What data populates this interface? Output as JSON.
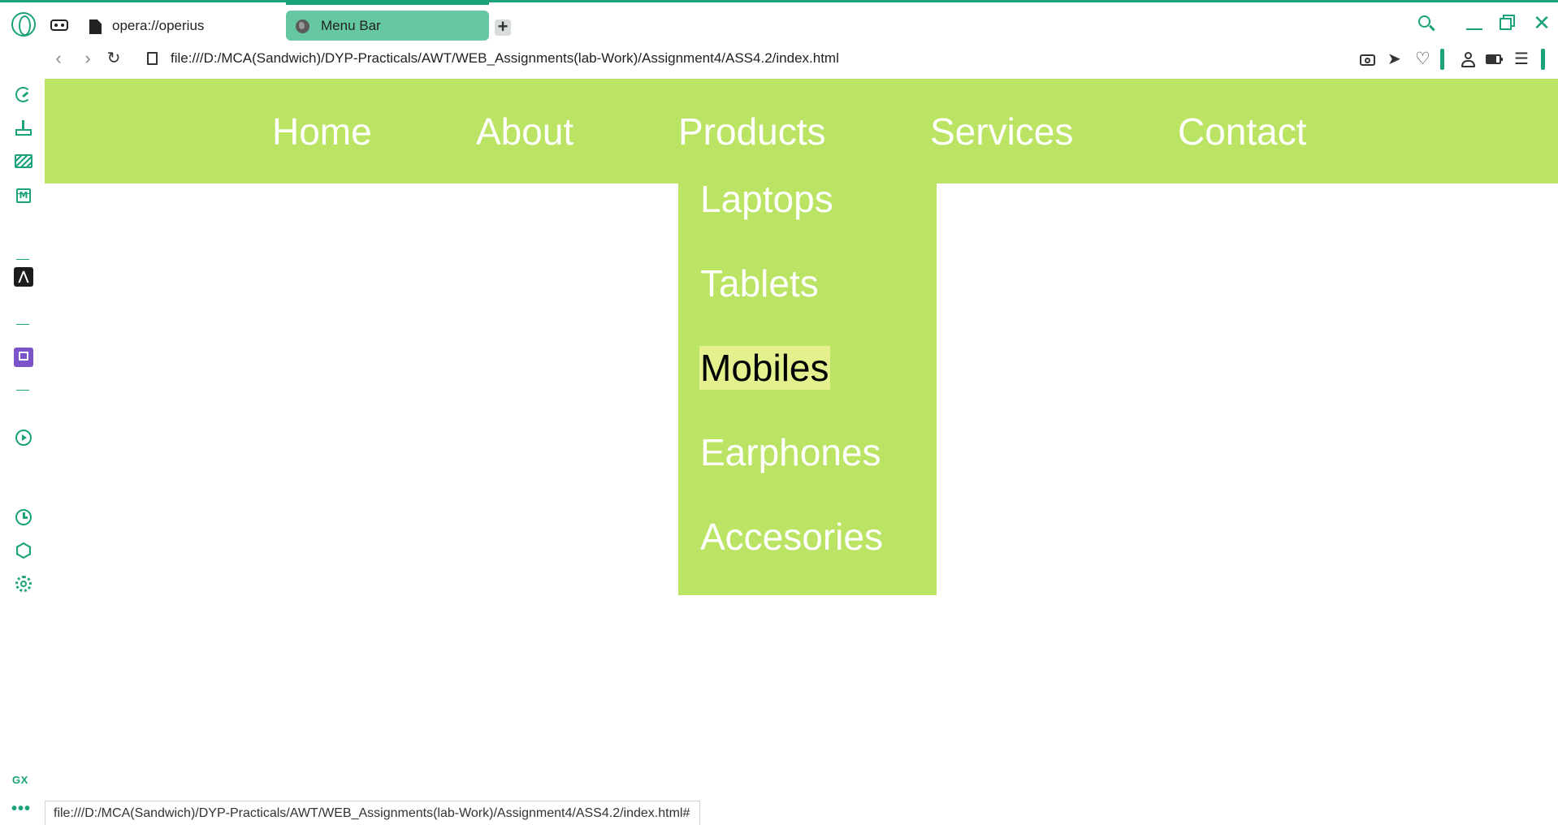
{
  "browser": {
    "tabs": [
      {
        "label": "opera://operius"
      },
      {
        "label": "Menu Bar"
      }
    ],
    "address": "file:///D:/MCA(Sandwich)/DYP-Practicals/AWT/WEB_Assignments(lab-Work)/Assignment4/ASS4.2/index.html",
    "sidebar_footer": "GX",
    "more_label": "•••",
    "status_url": "file:///D:/MCA(Sandwich)/DYP-Practicals/AWT/WEB_Assignments(lab-Work)/Assignment4/ASS4.2/index.html#",
    "accent_color": "#1aa37a"
  },
  "icons": {
    "back": "‹",
    "forward": "›",
    "reload": "↻",
    "close": "✕",
    "send": "➤",
    "heart": "♡",
    "easy_setup": "☰",
    "new_tab": "+",
    "sidebar_arrow_app": "⋀"
  },
  "page": {
    "menu": {
      "items": [
        "Home",
        "About",
        "Products",
        "Services",
        "Contact"
      ],
      "background": "#bbe364"
    },
    "dropdown": {
      "items": [
        "Laptops",
        "Tablets",
        "Mobiles",
        "Earphones",
        "Accesories"
      ],
      "hovered": "Mobiles",
      "hover_color": "#e3f08d"
    }
  }
}
